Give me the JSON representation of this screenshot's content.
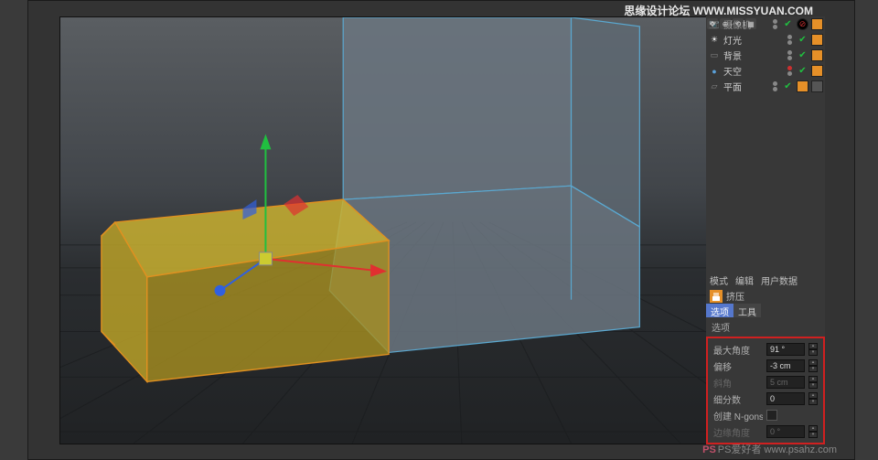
{
  "watermark": "思缘设计论坛   WWW.MISSYUAN.COM",
  "bottom_watermark": "PS爱好者 www.psahz.com",
  "objects": [
    {
      "name": "摄像机",
      "color": "#888"
    },
    {
      "name": "灯光",
      "color": "#ddd"
    },
    {
      "name": "背景",
      "color": "#888"
    },
    {
      "name": "天空",
      "color": "#5aa0d8"
    },
    {
      "name": "平面",
      "color": "#888"
    }
  ],
  "attr_tabs": {
    "mode": "模式",
    "edit": "编辑",
    "user": "用户数据"
  },
  "tool_name": "挤压",
  "subtabs": {
    "options": "选项",
    "tool": "工具"
  },
  "section": "选项",
  "params": {
    "max_angle": {
      "label": "最大角度",
      "value": "91 °"
    },
    "offset": {
      "label": "偏移",
      "value": "-3 cm"
    },
    "bevel": {
      "label": "斜角",
      "value": "5 cm"
    },
    "subdiv": {
      "label": "细分数",
      "value": "0"
    },
    "ngons": {
      "label": "创建 N-gons"
    },
    "edge_angle": {
      "label": "边缘角度",
      "value": "0 °"
    }
  }
}
